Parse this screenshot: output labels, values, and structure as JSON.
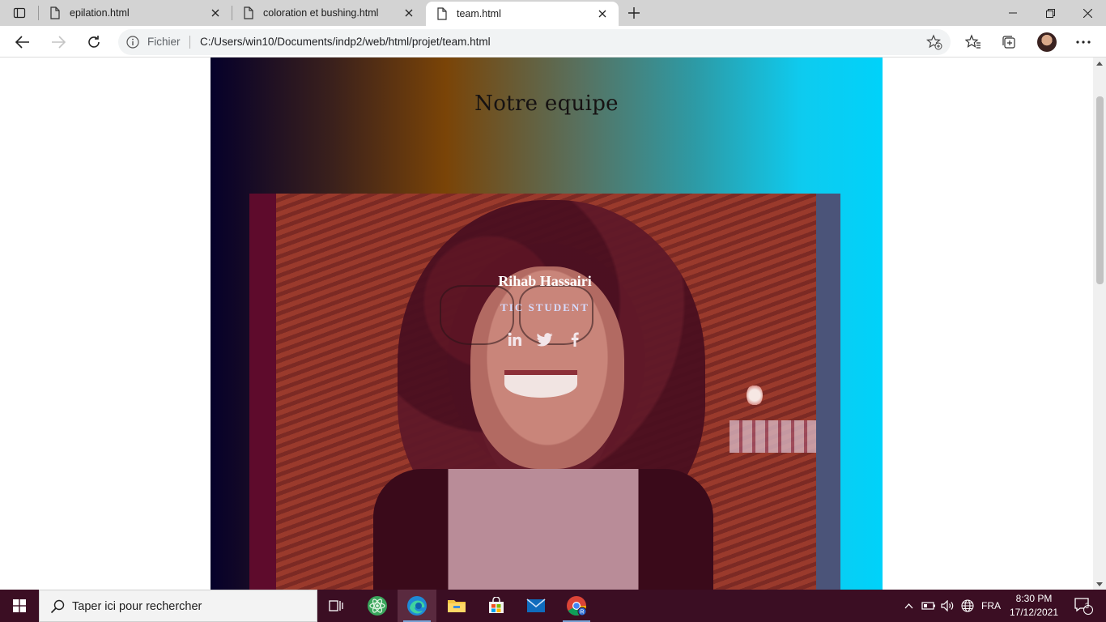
{
  "browser": {
    "tabs": [
      {
        "title": "epilation.html",
        "active": false
      },
      {
        "title": "coloration et bushing.html",
        "active": false
      },
      {
        "title": "team.html",
        "active": true
      }
    ],
    "address": {
      "scheme_label": "Fichier",
      "url": "C:/Users/win10/Documents/indp2/web/html/projet/team.html"
    }
  },
  "page": {
    "section_title": "Notre equipe",
    "member": {
      "name": "Rihab Hassairi",
      "role": "TIC STUDENT",
      "socials": [
        "linkedin-icon",
        "twitter-icon",
        "facebook-icon"
      ]
    }
  },
  "taskbar": {
    "search_placeholder": "Taper ici pour rechercher",
    "language": "FRA",
    "time": "8:30 PM",
    "date": "17/12/2021",
    "notification_count": "3"
  },
  "colors": {
    "taskbar": "#3b0e23",
    "section_gradient_start": "#05002a",
    "section_gradient_mid": "#7a4407",
    "section_gradient_end": "#00d2fa",
    "card_overlay": "#6a1736"
  }
}
